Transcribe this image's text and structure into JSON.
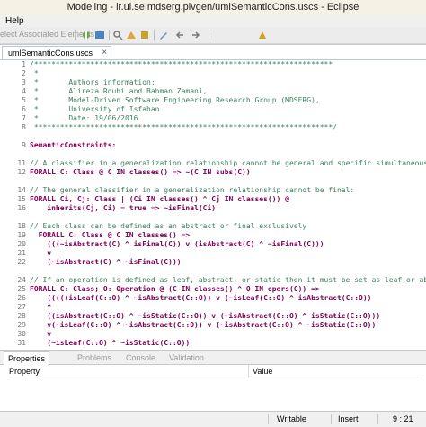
{
  "window": {
    "title": "Modeling - ir.ui.se.mdserg.plvgen/umlSemanticCons.uscs - Eclipse"
  },
  "menu": {
    "items": [
      "Help"
    ]
  },
  "toolbar": {
    "select_label": "elect Associated Elements"
  },
  "editor": {
    "tab_label": "umlSemanticCons.uscs",
    "close_icon": "×",
    "lines": [
      {
        "n": "1",
        "segments": [
          {
            "t": "/*********************************************************************",
            "c": "c"
          }
        ]
      },
      {
        "n": "2",
        "segments": [
          {
            "t": " *",
            "c": "c"
          }
        ]
      },
      {
        "n": "3",
        "segments": [
          {
            "t": " *       Authors information:",
            "c": "c"
          }
        ]
      },
      {
        "n": "4",
        "segments": [
          {
            "t": " *       Alireza Rouhi and Bahman Zamani,",
            "c": "c"
          }
        ]
      },
      {
        "n": "5",
        "segments": [
          {
            "t": " *       Model-Driven Software Engineering Research Group (MDSERG),",
            "c": "c"
          }
        ]
      },
      {
        "n": "6",
        "segments": [
          {
            "t": " *       University of Isfahan",
            "c": "c"
          }
        ]
      },
      {
        "n": "7",
        "segments": [
          {
            "t": " *       Date: 19/06/2016",
            "c": "c"
          }
        ]
      },
      {
        "n": "8",
        "segments": [
          {
            "t": " *********************************************************************/",
            "c": "c"
          }
        ]
      },
      {
        "n": "",
        "segments": []
      },
      {
        "n": "9",
        "segments": [
          {
            "t": "SemanticConstraints:",
            "c": "k"
          }
        ]
      },
      {
        "n": "",
        "segments": []
      },
      {
        "n": "11",
        "segments": [
          {
            "t": "// A classifier in a generalization relationship cannot be general and specific simultaneously in",
            "c": "c"
          }
        ]
      },
      {
        "n": "12",
        "segments": [
          {
            "t": "FORALL C: Class @ C IN classes() => ~(C IN subs(C))",
            "c": "k"
          }
        ]
      },
      {
        "n": "",
        "segments": []
      },
      {
        "n": "14",
        "segments": [
          {
            "t": "// The general classifier in a generalization relationship cannot be final:",
            "c": "c"
          }
        ]
      },
      {
        "n": "15",
        "segments": [
          {
            "t": "FORALL Ci, Cj: Class | (Ci IN classes() ^ Cj IN classes()) @",
            "c": "k"
          }
        ]
      },
      {
        "n": "16",
        "segments": [
          {
            "t": "    inherits(Cj, Ci) = true => ~isFinal(Ci)",
            "c": "k"
          }
        ]
      },
      {
        "n": "",
        "segments": []
      },
      {
        "n": "18",
        "segments": [
          {
            "t": "// Each class can be defined as an abstract or final exclusively",
            "c": "c"
          }
        ]
      },
      {
        "n": "19",
        "segments": [
          {
            "t": "  FORALL C: Class @ C IN classes() =>",
            "c": "k"
          }
        ]
      },
      {
        "n": "20",
        "segments": [
          {
            "t": "    (((~isAbstract(C) ^ isFinal(C)) v (isAbstract(C) ^ ~isFinal(C)))",
            "c": "k"
          }
        ]
      },
      {
        "n": "21",
        "segments": [
          {
            "t": "    v",
            "c": "k"
          }
        ]
      },
      {
        "n": "22",
        "segments": [
          {
            "t": "    (~isAbstract(C) ^ ~isFinal(C)))",
            "c": "k"
          }
        ]
      },
      {
        "n": "",
        "segments": []
      },
      {
        "n": "24",
        "segments": [
          {
            "t": "// If an operation is defined as leaf, abstract, or static then it must be set as leaf or abstract",
            "c": "c"
          }
        ]
      },
      {
        "n": "25",
        "segments": [
          {
            "t": "FORALL C: Class; O: Operation @ (C IN classes() ^ O IN opers(C)) =>",
            "c": "k"
          }
        ]
      },
      {
        "n": "26",
        "segments": [
          {
            "t": "    (((((isLeaf(C::O) ^ ~isAbstract(C::O)) v (~isLeaf(C::O) ^ isAbstract(C::O))",
            "c": "k"
          }
        ]
      },
      {
        "n": "27",
        "segments": [
          {
            "t": "    ^",
            "c": "k"
          }
        ]
      },
      {
        "n": "28",
        "segments": [
          {
            "t": "    ((isAbstract(C::O) ^ ~isStatic(C::O)) v (~isAbstract(C::O) ^ isStatic(C::O)))",
            "c": "k"
          }
        ]
      },
      {
        "n": "29",
        "segments": [
          {
            "t": "    v(~isLeaf(C::O) ^ ~isAbstract(C::O)) v (~isAbstract(C::O) ^ ~isStatic(C::O))",
            "c": "k"
          }
        ]
      },
      {
        "n": "30",
        "segments": [
          {
            "t": "    v",
            "c": "k"
          }
        ]
      },
      {
        "n": "31",
        "segments": [
          {
            "t": "    (~isLeaf(C::O) ^ ~isStatic(C::O))",
            "c": "k"
          }
        ]
      }
    ]
  },
  "properties": {
    "tabs": [
      {
        "label": "Properties",
        "active": true
      },
      {
        "label": "Problems",
        "active": false
      },
      {
        "label": "Console",
        "active": false
      },
      {
        "label": "Validation",
        "active": false
      }
    ],
    "col_property": "Property",
    "col_value": "Value"
  },
  "status": {
    "writable": "Writable",
    "insert": "Insert",
    "position": "9 : 21"
  },
  "icons": [
    "select-icon",
    "run-icon",
    "search-icon",
    "navigate-icon",
    "refresh-icon",
    "edit-icon",
    "back-icon",
    "forward-icon",
    "plugin-icon"
  ]
}
